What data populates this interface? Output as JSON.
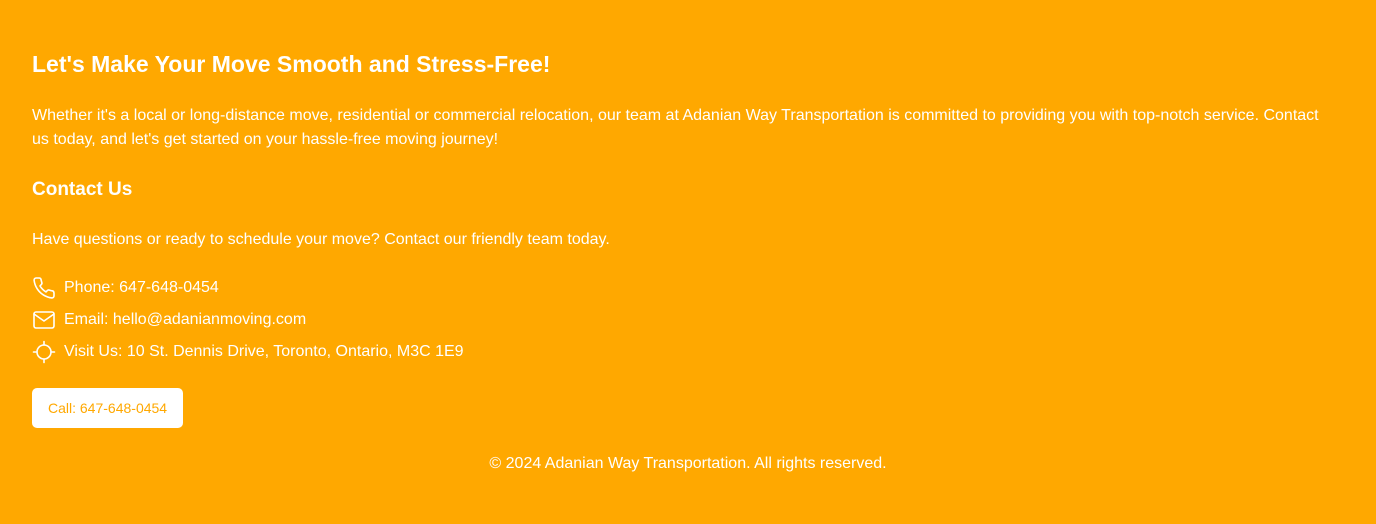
{
  "hero": {
    "headline": "Let's Make Your Move Smooth and Stress-Free!",
    "intro": "Whether it's a local or long-distance move, residential or commercial relocation, our team at Adanian Way Transportation is committed to providing you with top-notch service. Contact us today, and let's get started on your hassle-free moving journey!"
  },
  "contact": {
    "heading": "Contact Us",
    "description": "Have questions or ready to schedule your move? Contact our friendly team today.",
    "items": [
      {
        "icon": "phone-icon",
        "text": "Phone: 647-648-0454"
      },
      {
        "icon": "mail-icon",
        "text": "Email: hello@adanianmoving.com"
      },
      {
        "icon": "location-icon",
        "text": "Visit Us: 10 St. Dennis Drive, Toronto, Ontario, M3C 1E9"
      }
    ],
    "call_button_label": "Call: 647-648-0454"
  },
  "footer": {
    "copyright": "© 2024 Adanian Way Transportation. All rights reserved."
  },
  "colors": {
    "background": "#FFA800",
    "text": "#FFFFFF",
    "button_background": "#FFFFFF",
    "button_text": "#FFA800"
  }
}
